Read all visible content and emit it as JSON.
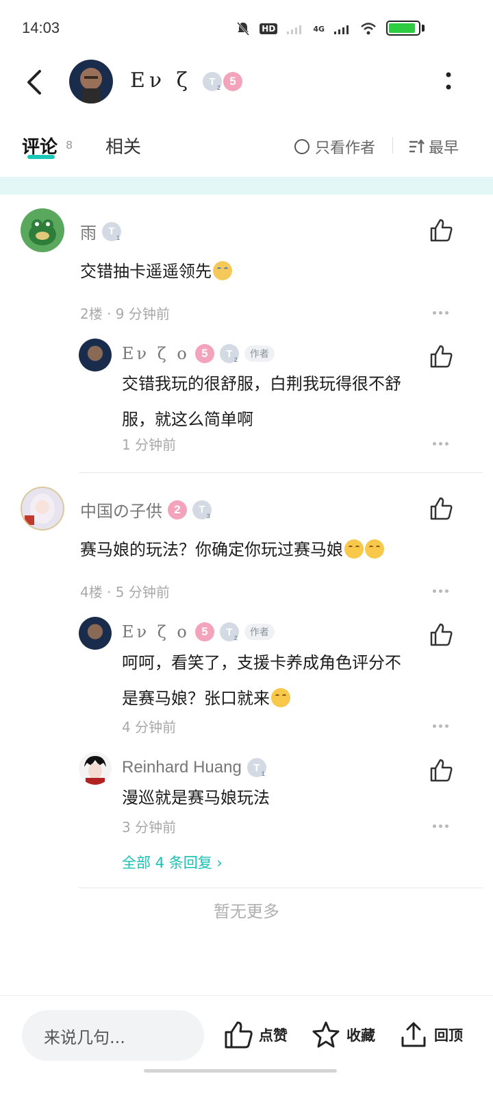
{
  "status": {
    "time": "14:03",
    "network": "4G",
    "hd_label": "HD",
    "battery_level": 0.9
  },
  "header": {
    "author_name": "Εν ζ ο",
    "author_level": "5",
    "author_badge_text": "T",
    "author_badge_sub": "2"
  },
  "tabs": {
    "comments_label": "评论",
    "comments_count": "8",
    "related_label": "相关",
    "only_author_label": "只看作者",
    "sort_label": "最早"
  },
  "comments": [
    {
      "name": "雨",
      "badge_text": "T",
      "badge_sub": "1",
      "text": "交错抽卡遥遥领先",
      "meta": "2楼 · 9 分钟前",
      "replies": [
        {
          "name": "Εν ζ ο",
          "level": "5",
          "badge_text": "T",
          "badge_sub": "2",
          "author_tag": "作者",
          "text_line1": "交错我玩的很舒服，白荆我玩得很不舒",
          "text_line2": "服，就这么简单啊",
          "meta": "1 分钟前"
        }
      ]
    },
    {
      "name": "中国の子供",
      "level": "2",
      "badge_text": "T",
      "badge_sub": "3",
      "text": "赛马娘的玩法？你确定你玩过赛马娘",
      "meta": "4楼 · 5 分钟前",
      "replies": [
        {
          "name": "Εν ζ ο",
          "level": "5",
          "badge_text": "T",
          "badge_sub": "2",
          "author_tag": "作者",
          "text_line1": "呵呵，看笑了，支援卡养成角色评分不",
          "text_line2": "是赛马娘？张口就来",
          "meta": "4 分钟前"
        },
        {
          "name": "Reinhard Huang",
          "badge_text": "T",
          "badge_sub": "1",
          "text_line1": "漫巡就是赛马娘玩法",
          "meta": "3 分钟前"
        }
      ],
      "view_all": "全部 4 条回复 ›"
    }
  ],
  "no_more": "暂无更多",
  "bottom_bar": {
    "input_placeholder": "来说几句...",
    "like_label": "点赞",
    "favorite_label": "收藏",
    "top_label": "回顶"
  },
  "colors": {
    "accent": "#19c8b9",
    "level_badge": "#f4a3bc",
    "t_badge": "#d3dae3"
  }
}
